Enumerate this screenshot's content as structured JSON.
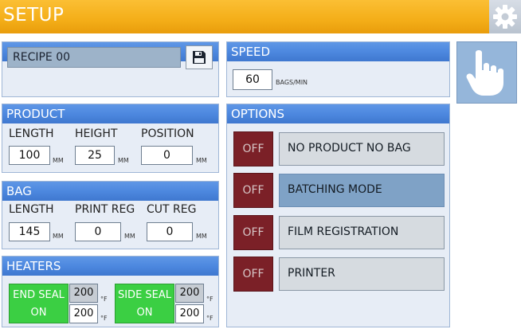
{
  "header": {
    "title": "SETUP"
  },
  "recipe": {
    "title": "RECIPE",
    "value": "RECIPE 00"
  },
  "speed": {
    "title": "SPEED",
    "value": "60",
    "unit": "BAGS/MIN"
  },
  "product": {
    "title": "PRODUCT",
    "length_label": "LENGTH",
    "length_value": "100",
    "length_unit": "MM",
    "height_label": "HEIGHT",
    "height_value": "25",
    "height_unit": "MM",
    "position_label": "POSITION",
    "position_value": "0",
    "position_unit": "MM"
  },
  "bag": {
    "title": "BAG",
    "length_label": "LENGTH",
    "length_value": "145",
    "length_unit": "MM",
    "printreg_label": "PRINT REG",
    "printreg_value": "0",
    "printreg_unit": "MM",
    "cutreg_label": "CUT REG",
    "cutreg_value": "0",
    "cutreg_unit": "MM"
  },
  "heaters": {
    "title": "HEATERS",
    "end_seal": {
      "line1": "END SEAL",
      "line2": "ON",
      "actual": "200",
      "set": "200",
      "unit": "°F"
    },
    "side_seal": {
      "line1": "SIDE SEAL",
      "line2": "ON",
      "actual": "200",
      "set": "200",
      "unit": "°F"
    }
  },
  "options": {
    "title": "OPTIONS",
    "items": [
      {
        "state": "OFF",
        "label": "NO PRODUCT NO BAG"
      },
      {
        "state": "OFF",
        "label": "BATCHING MODE"
      },
      {
        "state": "OFF",
        "label": "FILM REGISTRATION"
      },
      {
        "state": "OFF",
        "label": "PRINTER"
      }
    ]
  },
  "icons": {
    "settings": "gear-icon",
    "save": "floppy-disk-icon",
    "manual": "hand-pointer-icon"
  },
  "colors": {
    "header_bar": "#f4ae18",
    "panel_header": "#4d88df",
    "panel_bg": "#e7edf6",
    "option_off": "#7b2027",
    "option_active": "#7fa2c6",
    "heater_on": "#3bcf43"
  }
}
